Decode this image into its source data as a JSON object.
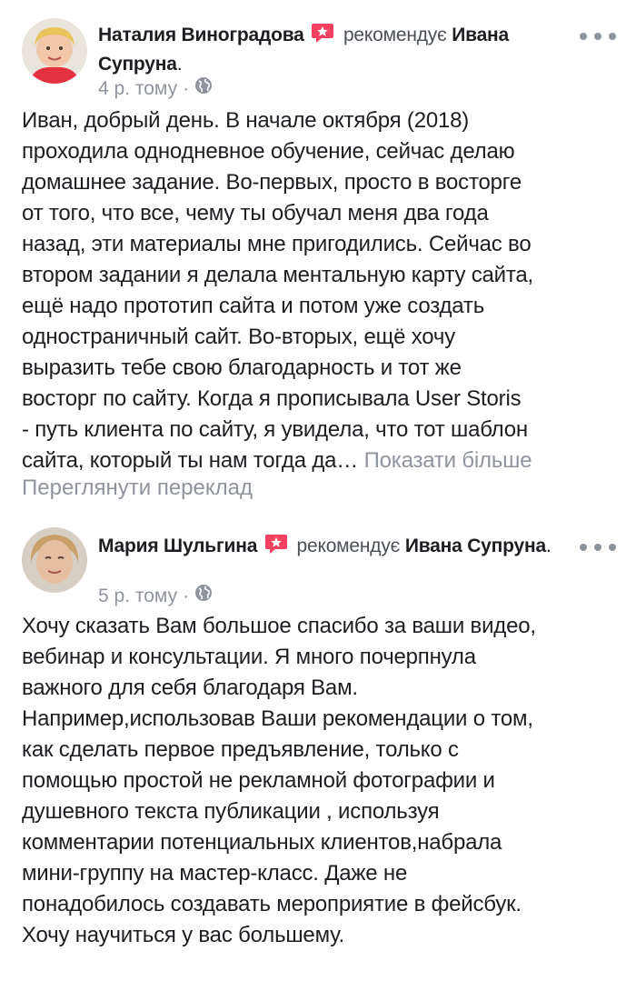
{
  "reviews": [
    {
      "author": "Наталия Виноградова",
      "recommends_text": "рекомендує",
      "target": "Ивана Супруна",
      "period": ".",
      "time": "4 р. тому",
      "separator": "·",
      "audience_icon": "globe-icon",
      "body_lines": [
        "Иван, добрый день. В начале октября (2018)",
        "проходила однодневное обучение, сейчас делаю",
        "домашнее задание. Во-первых, просто в восторге",
        "от того, что все, чему ты обучал меня два года",
        "назад, эти материалы мне пригодились. Сейчас во",
        "втором задании я делала ментальную карту сайта,",
        "ещё надо прототип сайта и потом уже создать",
        "одностраничный сайт. Во-вторых, ещё хочу",
        "выразить тебе свою благодарность и тот же",
        "восторг по сайту. Когда я прописывала User Storis",
        "- путь клиента по сайту, я увидела, что тот шаблон"
      ],
      "last_line": "сайта, который ты нам тогда да…",
      "see_more": "Показати більше",
      "translate": "Переглянути переклад"
    },
    {
      "author": "Мария Шульгина",
      "recommends_text": "рекомендує",
      "target": "Ивана Супруна",
      "period": ".",
      "time": "5 р. тому",
      "separator": "·",
      "audience_icon": "globe-icon",
      "body_lines": [
        "Хочу сказать Вам большое спасибо за ваши видео,",
        "вебинар и консультации. Я много почерпнула",
        "важного для себя благодаря Вам.",
        "Например,использовав Ваши рекомендации о том,",
        "как сделать первое предъявление, только с",
        "помощью простой не рекламной фотографии и",
        "душевного текста публикации , используя",
        "комментарии потенциальных клиентов,набрала",
        "мини-группу на мастер-класс. Даже не",
        "понадобилось создавать мероприятие в фейсбук.",
        "Хочу научиться у вас большему."
      ]
    }
  ],
  "colors": {
    "recommend_badge": "#f3425f",
    "secondary_text": "#90949c",
    "primary_text": "#1c1e21"
  }
}
